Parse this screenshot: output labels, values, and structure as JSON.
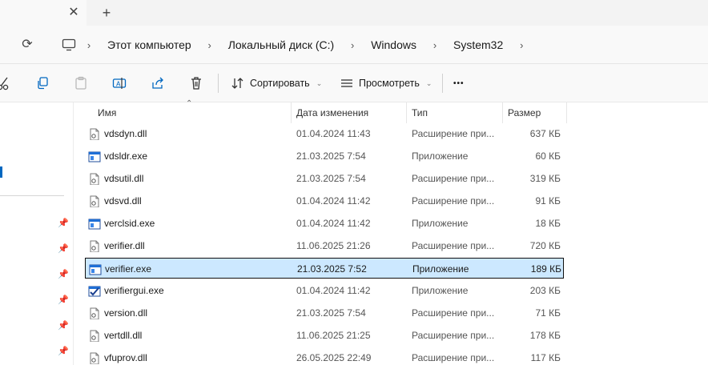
{
  "tabstrip": {
    "close_glyph": "✕",
    "new_tab_glyph": "+"
  },
  "addressbar": {
    "refresh_glyph": "⟳",
    "separator": "›",
    "breadcrumbs": [
      "Этот компьютер",
      "Локальный диск (C:)",
      "Windows",
      "System32"
    ]
  },
  "commandbar": {
    "sort_label": "Сортировать",
    "view_label": "Просмотреть",
    "more_label": "•••",
    "chevron": "⌄"
  },
  "columns": {
    "name": "Имя",
    "date": "Дата изменения",
    "type": "Тип",
    "size": "Размер",
    "sort_glyph": "⌃"
  },
  "nav": {
    "pin_glyph": "📌"
  },
  "files": [
    {
      "name": "vdsdyn.dll",
      "date": "01.04.2024 11:43",
      "type": "Расширение при...",
      "size": "637 КБ",
      "icon": "dll"
    },
    {
      "name": "vdsldr.exe",
      "date": "21.03.2025 7:54",
      "type": "Приложение",
      "size": "60 КБ",
      "icon": "exe"
    },
    {
      "name": "vdsutil.dll",
      "date": "21.03.2025 7:54",
      "type": "Расширение при...",
      "size": "319 КБ",
      "icon": "dll"
    },
    {
      "name": "vdsvd.dll",
      "date": "01.04.2024 11:42",
      "type": "Расширение при...",
      "size": "91 КБ",
      "icon": "dll"
    },
    {
      "name": "verclsid.exe",
      "date": "01.04.2024 11:42",
      "type": "Приложение",
      "size": "18 КБ",
      "icon": "exe"
    },
    {
      "name": "verifier.dll",
      "date": "11.06.2025 21:26",
      "type": "Расширение при...",
      "size": "720 КБ",
      "icon": "dll"
    },
    {
      "name": "verifier.exe",
      "date": "21.03.2025 7:52",
      "type": "Приложение",
      "size": "189 КБ",
      "icon": "exe"
    },
    {
      "name": "verifiergui.exe",
      "date": "01.04.2024 11:42",
      "type": "Приложение",
      "size": "203 КБ",
      "icon": "checkmark-app"
    },
    {
      "name": "version.dll",
      "date": "21.03.2025 7:54",
      "type": "Расширение при...",
      "size": "71 КБ",
      "icon": "dll"
    },
    {
      "name": "vertdll.dll",
      "date": "11.06.2025 21:25",
      "type": "Расширение при...",
      "size": "178 КБ",
      "icon": "dll"
    },
    {
      "name": "vfuprov.dll",
      "date": "26.05.2025 22:49",
      "type": "Расширение при...",
      "size": "117 КБ",
      "icon": "dll"
    }
  ],
  "selected_index": 6,
  "colors": {
    "selection": "#cce8ff",
    "accent": "#0067c0"
  }
}
